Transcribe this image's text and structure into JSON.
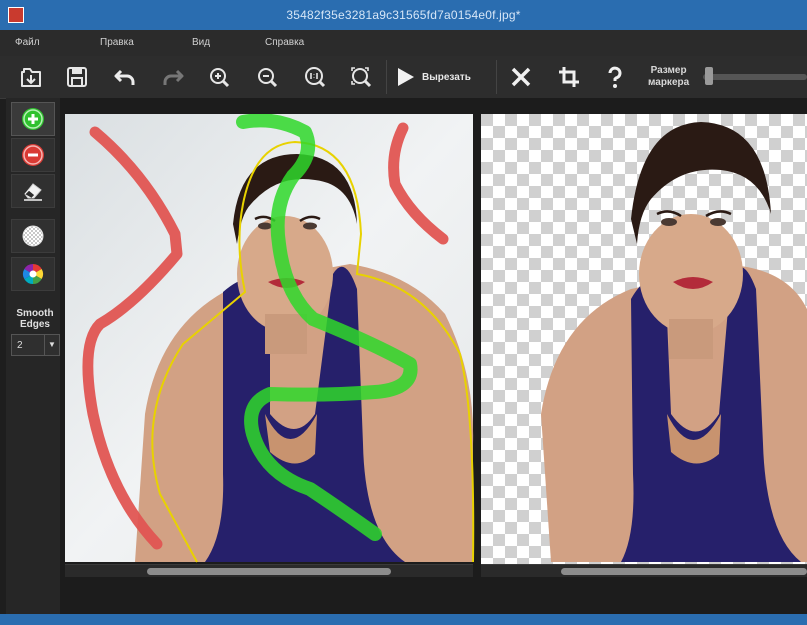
{
  "window": {
    "title": "35482f35e3281a9c31565fd7a0154e0f.jpg*"
  },
  "menu": [
    "Файл",
    "Правка",
    "Вид",
    "Справка"
  ],
  "toolbar": {
    "cut_label": "Вырезать",
    "marker_label_line1": "Размер",
    "marker_label_line2": "маркера",
    "marker_size_level": 0.02
  },
  "sidebar": {
    "smooth_label_line1": "Smooth",
    "smooth_label_line2": "Edges",
    "smooth_value": "2"
  },
  "colors": {
    "title_bar": "#2a6db0",
    "keep_marker": "#3cd13a",
    "remove_marker": "#e05552",
    "selection_outline": "#e8d200"
  },
  "icons": [
    "open-icon",
    "save-icon",
    "undo-icon",
    "redo-icon",
    "zoom-in-icon",
    "zoom-out-icon",
    "zoom-actual-icon",
    "zoom-fit-icon",
    "play-icon",
    "close-icon",
    "crop-icon",
    "help-icon",
    "plus-icon",
    "minus-icon",
    "eraser-icon",
    "circle-icon",
    "color-wheel-icon"
  ]
}
